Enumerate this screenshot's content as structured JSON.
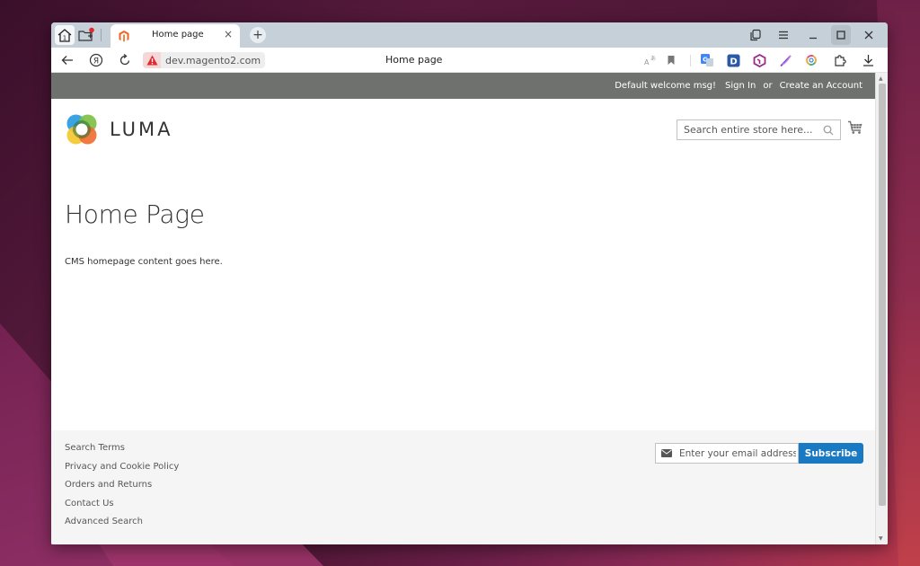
{
  "browser": {
    "tab": {
      "title": "Home page",
      "close_label": "×"
    },
    "new_tab_label": "+",
    "home_badge": "1",
    "url": "dev.magento2.com",
    "page_title": "Home page",
    "window_controls": {
      "minimize": "_",
      "maximize": "□",
      "close": "✕"
    },
    "icons": {
      "back": "←",
      "reload": "↻",
      "yandex": "Я",
      "download": "⤓"
    }
  },
  "store": {
    "topbar": {
      "welcome": "Default welcome msg!",
      "sign_in": "Sign In",
      "or": "or",
      "create_account": "Create an Account"
    },
    "logo_text": "LUMA",
    "search": {
      "placeholder": "Search entire store here..."
    },
    "page_heading": "Home Page",
    "cms_content": "CMS homepage content goes here.",
    "footer": {
      "links": [
        "Search Terms",
        "Privacy and Cookie Policy",
        "Orders and Returns",
        "Contact Us",
        "Advanced Search"
      ],
      "newsletter": {
        "placeholder": "Enter your email address",
        "button": "Subscribe"
      }
    }
  },
  "colors": {
    "topbar_bg": "#6e716e",
    "accent": "#1979c3",
    "tab_strip": "#c5d0d9",
    "footer_bg": "#f5f5f5"
  }
}
